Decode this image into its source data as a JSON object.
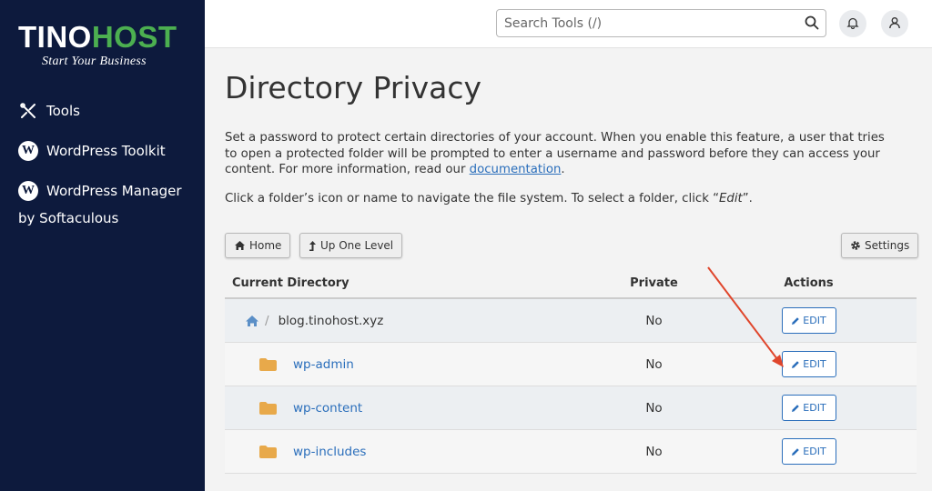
{
  "brand": {
    "name_part1": "TINO",
    "name_part2": "HOST",
    "tagline": "Start Your Business",
    "accent_color": "#4caf50"
  },
  "sidebar": {
    "items": [
      {
        "label": "Tools",
        "icon": "tools-icon"
      },
      {
        "label": "WordPress Toolkit",
        "icon": "wordpress-icon"
      },
      {
        "label": "WordPress Manager",
        "label_line2": "by Softaculous",
        "icon": "wordpress-icon"
      }
    ]
  },
  "header": {
    "search_placeholder": "Search Tools (/)",
    "search_icon": "search-icon",
    "notifications_icon": "bell-icon",
    "user_icon": "user-icon"
  },
  "page": {
    "title": "Directory Privacy",
    "description": "Set a password to protect certain directories of your account. When you enable this feature, a user that tries to open a protected folder will be prompted to enter a username and password before they can access your content. For more information, read our ",
    "doc_link": "documentation",
    "desc_end": ".",
    "hint_prefix": "Click a folder’s icon or name to navigate the file system. To select a folder, click “",
    "hint_em": "Edit",
    "hint_suffix": "”."
  },
  "toolbar": {
    "home_label": "Home",
    "up_label": "Up One Level",
    "settings_label": "Settings"
  },
  "table": {
    "headers": {
      "dir": "Current Directory",
      "private": "Private",
      "actions": "Actions"
    },
    "current": {
      "name": "blog.tinohost.xyz",
      "separator": "/",
      "private": "No",
      "action": "EDIT"
    },
    "rows": [
      {
        "name": "wp-admin",
        "private": "No",
        "action": "EDIT"
      },
      {
        "name": "wp-content",
        "private": "No",
        "action": "EDIT"
      },
      {
        "name": "wp-includes",
        "private": "No",
        "action": "EDIT"
      }
    ]
  },
  "colors": {
    "sidebar_bg": "#0d1a3d",
    "link": "#2a6ebb",
    "folder": "#e8a94a",
    "annotation_arrow": "#e0462c"
  }
}
